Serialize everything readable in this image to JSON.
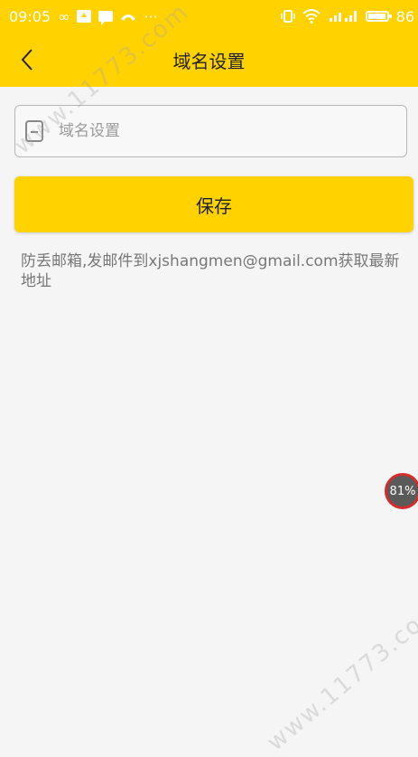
{
  "status_bar": {
    "time": "09:05",
    "battery_level": "86",
    "icons": [
      "infinity-icon",
      "upload-icon",
      "chat-icon",
      "call-icon",
      "more-icon",
      "vibrate-icon",
      "wifi-icon",
      "signal-icon",
      "battery-icon"
    ]
  },
  "nav": {
    "title": "域名设置",
    "back_icon": "chevron-left-icon"
  },
  "form": {
    "domain_placeholder": "域名设置",
    "domain_value": "",
    "field_icon": "document-icon"
  },
  "actions": {
    "save_label": "保存"
  },
  "hint": {
    "text": "防丢邮箱,发邮件到xjshangmen@gmail.com获取最新地址"
  },
  "floating": {
    "percent": "81%"
  },
  "watermark": {
    "text": "www.11773.com"
  },
  "colors": {
    "accent": "#ffd200",
    "background": "#f5f5f5",
    "hint_text": "#777777"
  }
}
